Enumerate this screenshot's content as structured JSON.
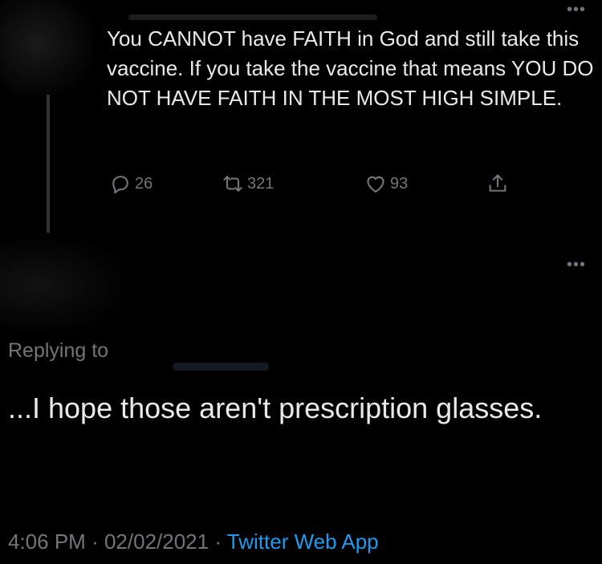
{
  "original_tweet": {
    "text": "You CANNOT have FAITH in God and still take this vaccine. If you take the vaccine that means YOU DO NOT HAVE FAITH IN THE MOST HIGH SIMPLE.",
    "reply_count": "26",
    "retweet_count": "321",
    "like_count": "93"
  },
  "reply_tweet": {
    "replying_to_label": "Replying to",
    "text": "...I hope those aren't prescription glasses.",
    "time": "4:06 PM",
    "separator": "·",
    "date": "02/02/2021",
    "source": "Twitter Web App"
  },
  "icons": {
    "more": "more-horizontal-icon",
    "reply": "speech-bubble-icon",
    "retweet": "retweet-arrows-icon",
    "like": "heart-icon",
    "share": "share-upload-icon"
  },
  "colors": {
    "background": "#000000",
    "text": "#e7e9ea",
    "muted": "#71767b",
    "link": "#1d9bf0"
  }
}
